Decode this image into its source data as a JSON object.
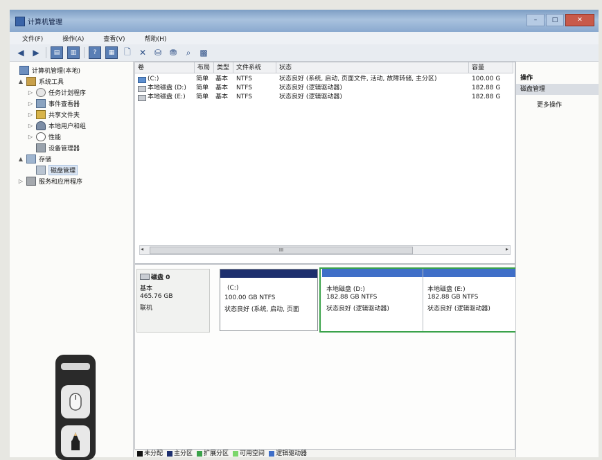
{
  "window": {
    "title": "计算机管理"
  },
  "menu": [
    {
      "label": "文件(F)"
    },
    {
      "label": "操作(A)"
    },
    {
      "label": "查看(V)"
    },
    {
      "label": "帮助(H)"
    }
  ],
  "tree": [
    {
      "label": "计算机管理(本地)",
      "icon": "computer-icon",
      "level": 0,
      "twisty": ""
    },
    {
      "label": "系统工具",
      "icon": "tools-icon",
      "level": 1,
      "twisty": "▲"
    },
    {
      "label": "任务计划程序",
      "icon": "clock-icon",
      "level": 2,
      "twisty": "▷"
    },
    {
      "label": "事件查看器",
      "icon": "event-viewer-icon",
      "level": 2,
      "twisty": "▷"
    },
    {
      "label": "共享文件夹",
      "icon": "shared-folder-icon",
      "level": 2,
      "twisty": "▷"
    },
    {
      "label": "本地用户和组",
      "icon": "users-icon",
      "level": 2,
      "twisty": "▷"
    },
    {
      "label": "性能",
      "icon": "performance-icon",
      "level": 2,
      "twisty": "▷"
    },
    {
      "label": "设备管理器",
      "icon": "device-manager-icon",
      "level": 2,
      "twisty": ""
    },
    {
      "label": "存储",
      "icon": "storage-icon",
      "level": 1,
      "twisty": "▲"
    },
    {
      "label": "磁盘管理",
      "icon": "disk-management-icon",
      "level": 2,
      "twisty": "",
      "selected": true
    },
    {
      "label": "服务和应用程序",
      "icon": "services-icon",
      "level": 1,
      "twisty": "▷"
    }
  ],
  "volumes": {
    "columns": [
      "卷",
      "布局",
      "类型",
      "文件系统",
      "状态",
      "容量"
    ],
    "rows": [
      {
        "name": "(C:)",
        "layout": "简单",
        "type": "基本",
        "fs": "NTFS",
        "status": "状态良好 (系统, 启动, 页面文件, 活动, 故障转储, 主分区)",
        "capacity": "100.00 G"
      },
      {
        "name": "本地磁盘 (D:)",
        "layout": "简单",
        "type": "基本",
        "fs": "NTFS",
        "status": "状态良好 (逻辑驱动器)",
        "capacity": "182.88 G"
      },
      {
        "name": "本地磁盘 (E:)",
        "layout": "简单",
        "type": "基本",
        "fs": "NTFS",
        "status": "状态良好 (逻辑驱动器)",
        "capacity": "182.88 G"
      }
    ],
    "scroll_thumb_label": "III"
  },
  "disk": {
    "name": "磁盘 0",
    "type": "基本",
    "size": "465.76 GB",
    "status": "联机",
    "partitions": [
      {
        "label": "(C:)",
        "size": "100.00 GB NTFS",
        "status": "状态良好 (系统, 启动, 页面",
        "bar_color": "#1d2f6e"
      },
      {
        "label": "本地磁盘 (D:)",
        "size": "182.88 GB NTFS",
        "status": "状态良好 (逻辑驱动器)",
        "bar_color": "#3f6fc8"
      },
      {
        "label": "本地磁盘 (E:)",
        "size": "182.88 GB NTFS",
        "status": "状态良好 (逻辑驱动器)",
        "bar_color": "#3f6fc8"
      }
    ]
  },
  "legend": [
    {
      "label": "未分配",
      "color": "#111111"
    },
    {
      "label": "主分区",
      "color": "#1d2f6e"
    },
    {
      "label": "扩展分区",
      "color": "#3aa24a"
    },
    {
      "label": "可用空间",
      "color": "#7bd66b"
    },
    {
      "label": "逻辑驱动器",
      "color": "#3f6fc8"
    }
  ],
  "actions": {
    "header": "操作",
    "section": "磁盘管理",
    "more": "更多操作"
  },
  "win_buttons": {
    "minimize": "–",
    "maximize": "□",
    "close": "✕"
  }
}
